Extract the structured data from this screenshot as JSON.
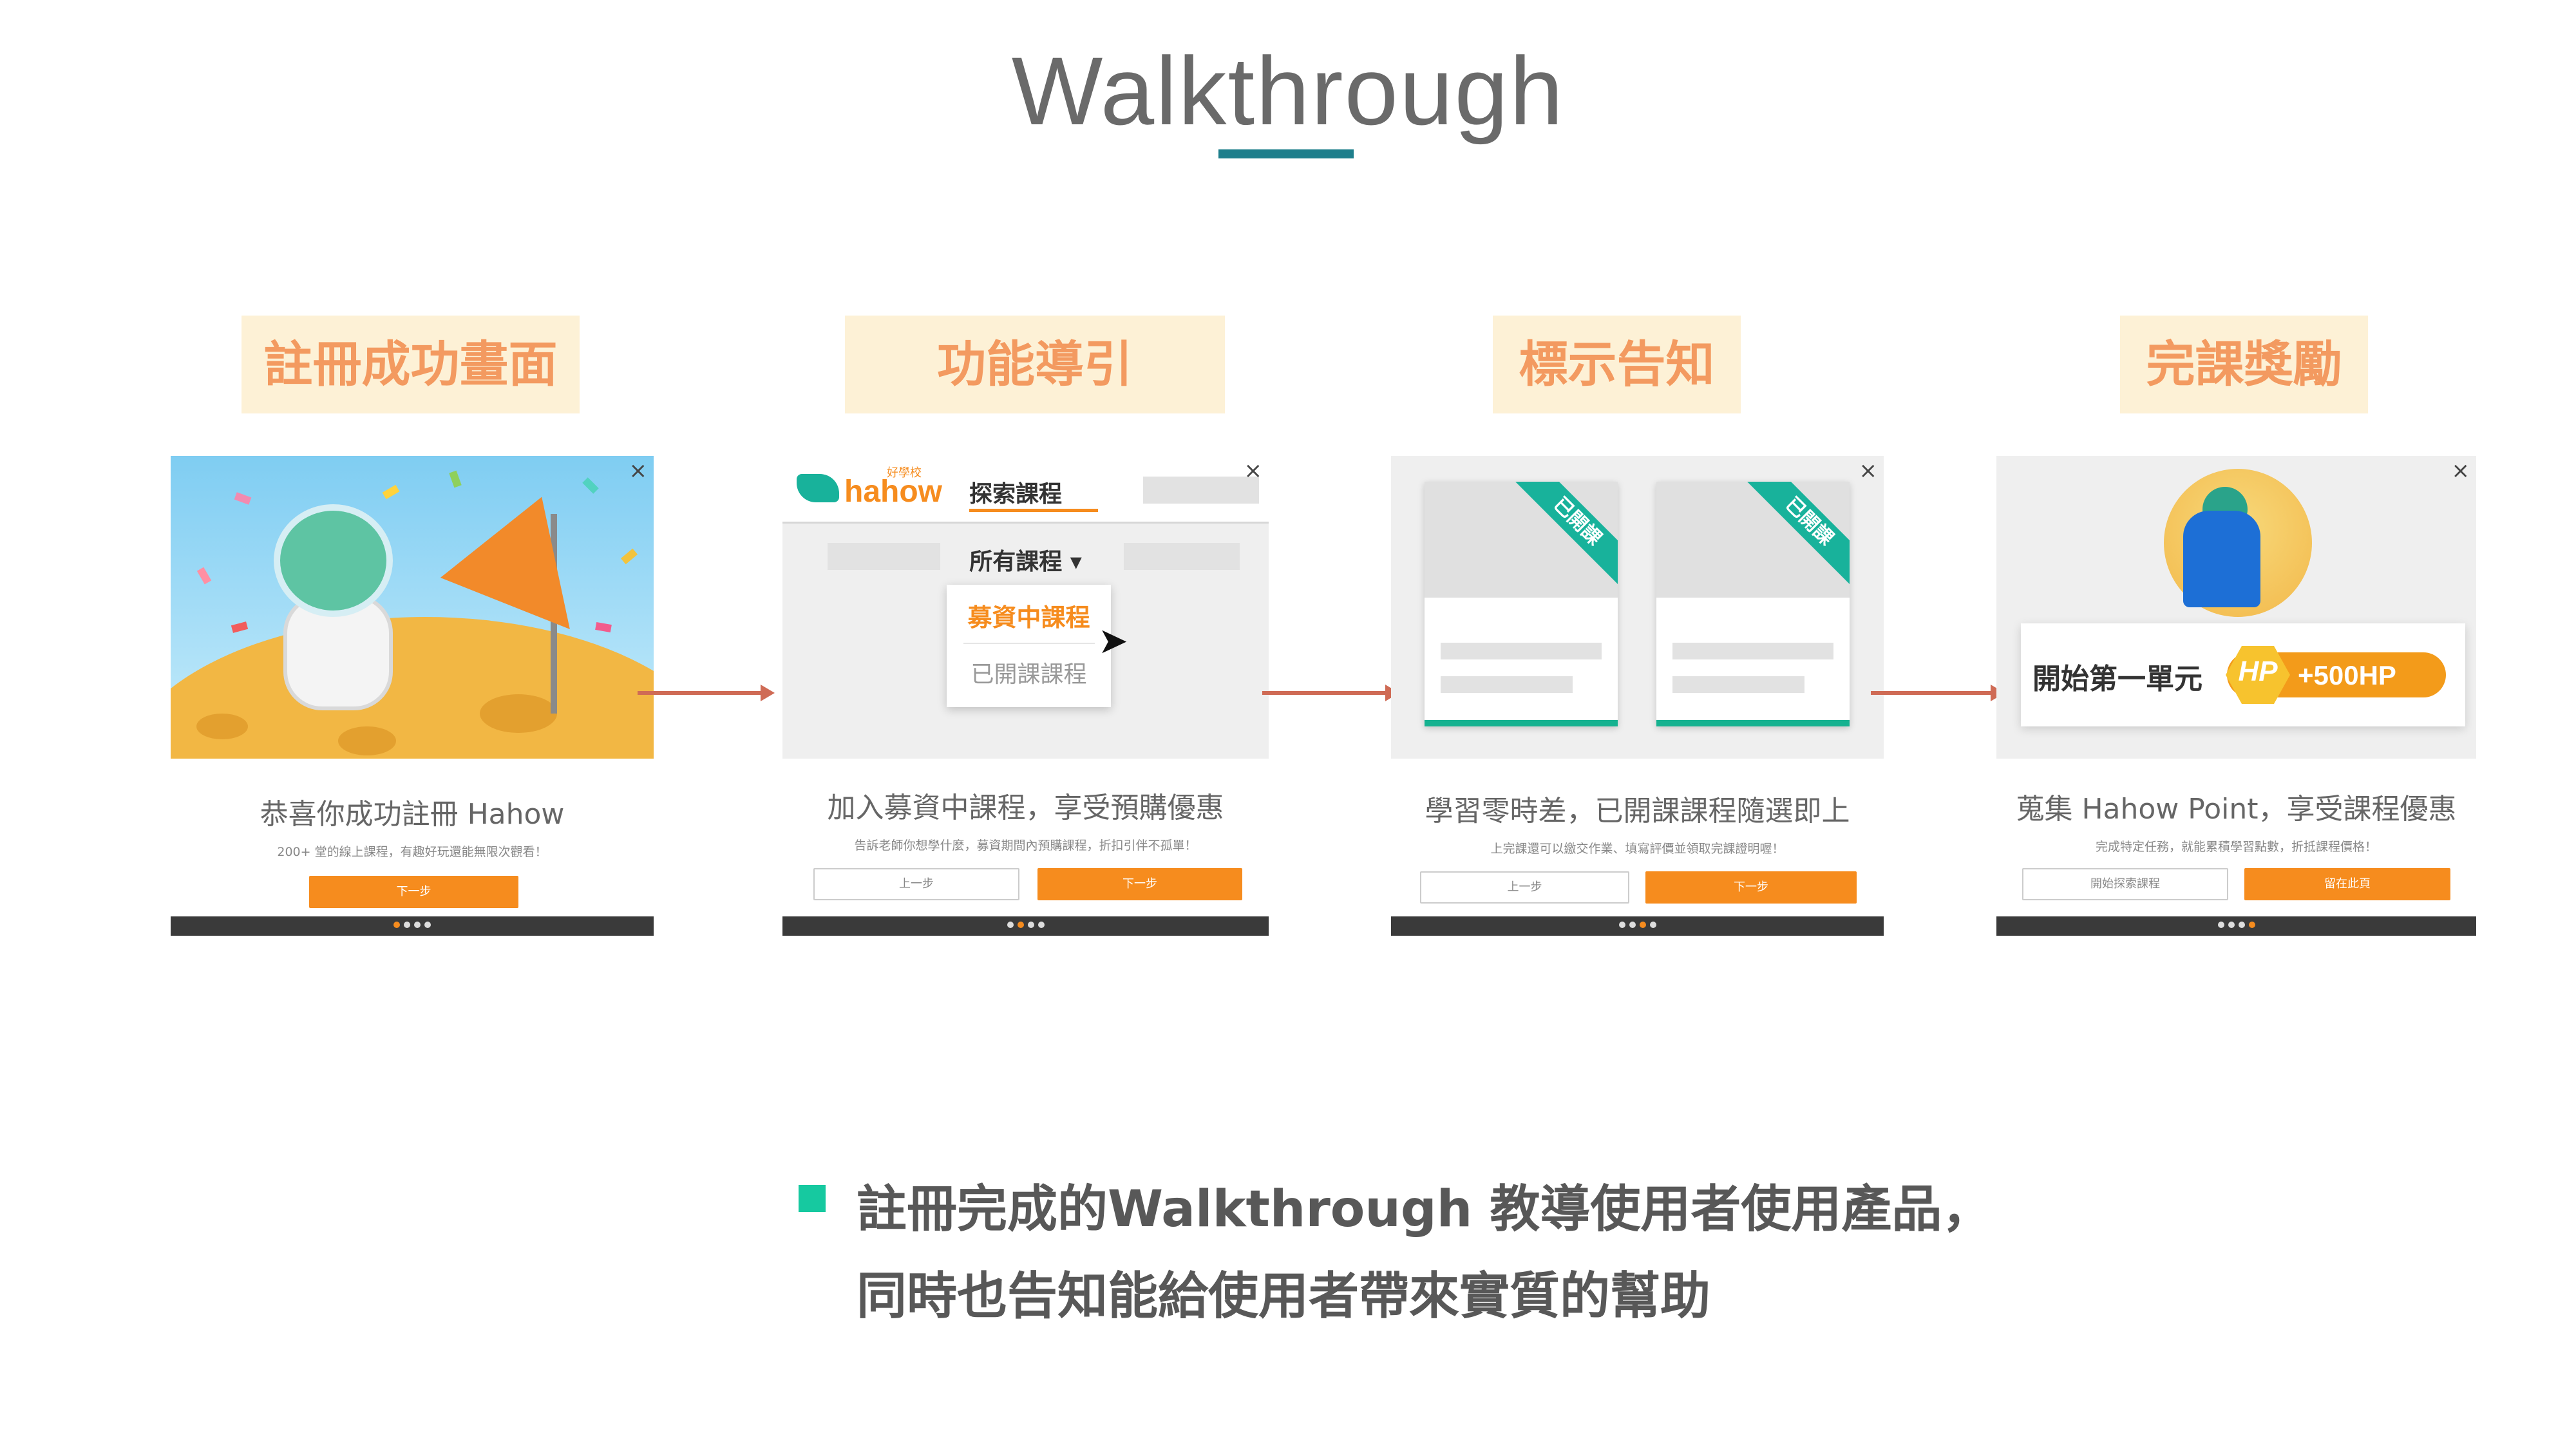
{
  "title": "Walkthrough",
  "steps": [
    {
      "label": "註冊成功畫面"
    },
    {
      "label": "功能導引"
    },
    {
      "label": "標示告知"
    },
    {
      "label": "完課獎勵"
    }
  ],
  "cards": [
    {
      "close": "×",
      "caption": "恭喜你成功註冊 Hahow",
      "sub": "200+ 堂的線上課程，有趣好玩還能無限次觀看！",
      "next": "下一步",
      "active_dot": 0
    },
    {
      "close": "×",
      "logo": "hahow",
      "logo_small": "好學校",
      "explore": "探索課程",
      "all_courses": "所有課程 ▾",
      "dropdown_item1": "募資中課程",
      "dropdown_item2": "已開課課程",
      "caption": "加入募資中課程，享受預購優惠",
      "sub": "告訴老師你想學什麼，募資期間內預購課程，折扣引伴不孤單！",
      "prev": "上一步",
      "next": "下一步",
      "active_dot": 1
    },
    {
      "close": "×",
      "ribbon": "已開課",
      "caption": "學習零時差，已開課課程隨選即上",
      "sub": "上完課還可以繳交作業、填寫評價並領取完課證明喔！",
      "prev": "上一步",
      "next": "下一步",
      "active_dot": 2
    },
    {
      "close": "×",
      "reward_text": "開始第一單元",
      "hp_badge": "HP",
      "hp_amount": "+500HP",
      "caption": "蒐集 Hahow Point，享受課程優惠",
      "sub": "完成特定任務，就能累積學習點數，折抵課程價格！",
      "prev": "開始探索課程",
      "next": "留在此頁",
      "active_dot": 3
    }
  ],
  "colors": {
    "title_underline": "#1e7f8c",
    "step_label_bg": "#fdf1d6",
    "step_label_text": "#f39a60",
    "arrow": "#cf6b55",
    "button_orange": "#f68c1e",
    "teal": "#18b29b",
    "bullet": "#16c9a0"
  },
  "bullet": {
    "line1": "註冊完成的Walkthrough  教導使用者使用產品，",
    "line2": "同時也告知能給使用者帶來實質的幫助"
  }
}
